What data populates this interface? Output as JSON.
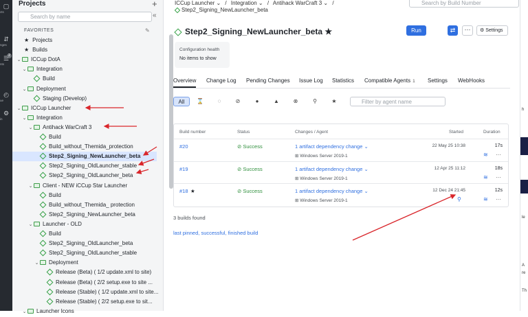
{
  "rail": {
    "items": [
      {
        "label": "cts",
        "icon": "folder-icon"
      },
      {
        "label": "nges",
        "icon": "changes-icon"
      },
      {
        "label": "nts",
        "icon": "agents-icon"
      },
      {
        "label": "ue",
        "icon": "queue-icon"
      },
      {
        "label": "in",
        "icon": "admin-icon"
      }
    ],
    "badge": "2"
  },
  "sidebar": {
    "title": "Projects",
    "search_placeholder": "Search by name",
    "favorites_label": "FAVORITES",
    "rows": [
      {
        "t": "Projects",
        "k": "star",
        "d": 0
      },
      {
        "t": "Builds",
        "k": "star",
        "d": 0
      },
      {
        "t": "ICCup DotA",
        "k": "folder",
        "d": 0,
        "caret": "⌄"
      },
      {
        "t": "Integration",
        "k": "folder",
        "d": 1,
        "caret": "⌄"
      },
      {
        "t": "Build",
        "k": "bt",
        "d": 2
      },
      {
        "t": "Deployment",
        "k": "folder",
        "d": 1,
        "caret": "⌄"
      },
      {
        "t": "Staging (Develop)",
        "k": "bt",
        "d": 2
      },
      {
        "t": "ICCup Launcher",
        "k": "folder",
        "d": 0,
        "caret": "⌄"
      },
      {
        "t": "Integration",
        "k": "folder",
        "d": 1,
        "caret": "⌄"
      },
      {
        "t": "Antihack WarCraft 3",
        "k": "folder",
        "d": 2,
        "caret": "⌄"
      },
      {
        "t": "Build",
        "k": "bt",
        "d": 3
      },
      {
        "t": "Build_without_Themida_protection",
        "k": "bt",
        "d": 3
      },
      {
        "t": "Step2_Signing_NewLauncher_beta",
        "k": "bt",
        "d": 3,
        "sel": true
      },
      {
        "t": "Step2_Signing_OldLauncher_stable",
        "k": "bt",
        "d": 3
      },
      {
        "t": "Step2_Signing_OldLauncher_beta",
        "k": "bt",
        "d": 3
      },
      {
        "t": "Client - NEW iCCup Star Launcher",
        "k": "folder",
        "d": 2,
        "caret": "⌄"
      },
      {
        "t": "Build",
        "k": "bt",
        "d": 3
      },
      {
        "t": "Build_without_Themida_ protection",
        "k": "bt",
        "d": 3
      },
      {
        "t": "Step2_Signing_NewLauncher_beta",
        "k": "bt",
        "d": 3
      },
      {
        "t": "Launcher - OLD",
        "k": "folder",
        "d": 2,
        "caret": "⌄"
      },
      {
        "t": "Build",
        "k": "bt",
        "d": 3
      },
      {
        "t": "Step2_Signing_OldLauncher_beta",
        "k": "bt",
        "d": 3
      },
      {
        "t": "Step2_Signing_OldLauncher_stable",
        "k": "bt",
        "d": 3
      },
      {
        "t": "Deployment",
        "k": "folder",
        "d": 3,
        "caret": "⌄"
      },
      {
        "t": "Release (Beta) ( 1/2 update.xml to site)",
        "k": "bt",
        "d": 4
      },
      {
        "t": "Release (Beta) ( 2/2 setup.exe to site ...",
        "k": "bt",
        "d": 4
      },
      {
        "t": "Release (Stable) ( 1/2 update.xml to site...",
        "k": "bt",
        "d": 4
      },
      {
        "t": "Release (Stable) ( 2/2 setup.exe to sit...",
        "k": "bt",
        "d": 4
      },
      {
        "t": "Launcher Icons",
        "k": "folder",
        "d": 1,
        "caret": "⌄"
      }
    ]
  },
  "main": {
    "breadcrumb": [
      "ICCup Launcher ⌄",
      "/",
      "Integration ⌄",
      "/",
      "Antihack WarCraft 3 ⌄",
      "/"
    ],
    "breadcrumb_current": "Step2_Signing_NewLauncher_beta",
    "top_search_placeholder": "Search by Build Number",
    "title": "Step2_Signing_NewLauncher_beta",
    "run_label": "Run",
    "settings_label": "Settings",
    "health_title": "Configuration health",
    "health_text": "No items to show",
    "tabs": [
      {
        "label": "Overview"
      },
      {
        "label": "Change Log"
      },
      {
        "label": "Pending Changes"
      },
      {
        "label": "Issue Log"
      },
      {
        "label": "Statistics"
      },
      {
        "label": "Compatible Agents",
        "count": "1"
      },
      {
        "label": "Settings"
      },
      {
        "label": "WebHooks"
      }
    ],
    "filter_all": "All",
    "agent_placeholder": "Filter by agent name",
    "headers": [
      "Build number",
      "Status",
      "Changes / Agent",
      "Started",
      "Duration"
    ],
    "builds": [
      {
        "number": "#20",
        "status": "Success",
        "changes": "1 artifact dependency change ⌄",
        "agent": "Windows Server 2019-1",
        "started": "22 May 25 10:38",
        "duration": "17s",
        "pinned": false
      },
      {
        "number": "#19",
        "status": "Success",
        "changes": "1 artifact dependency change ⌄",
        "agent": "Windows Server 2019-1",
        "started": "12 Apr 25 11:12",
        "duration": "18s",
        "pinned": false
      },
      {
        "number": "#18",
        "status": "Success",
        "changes": "1 artifact dependency change ⌄",
        "agent": "Windows Server 2019-1",
        "started": "12 Dec 24 21:45",
        "duration": "12s",
        "pinned": true
      }
    ],
    "found": "3 builds found",
    "last_link": "last pinned, successful, finished build"
  },
  "colors": {
    "accent": "#2f6fe0",
    "success": "#2f8f3c",
    "annotation": "#d9262b"
  }
}
